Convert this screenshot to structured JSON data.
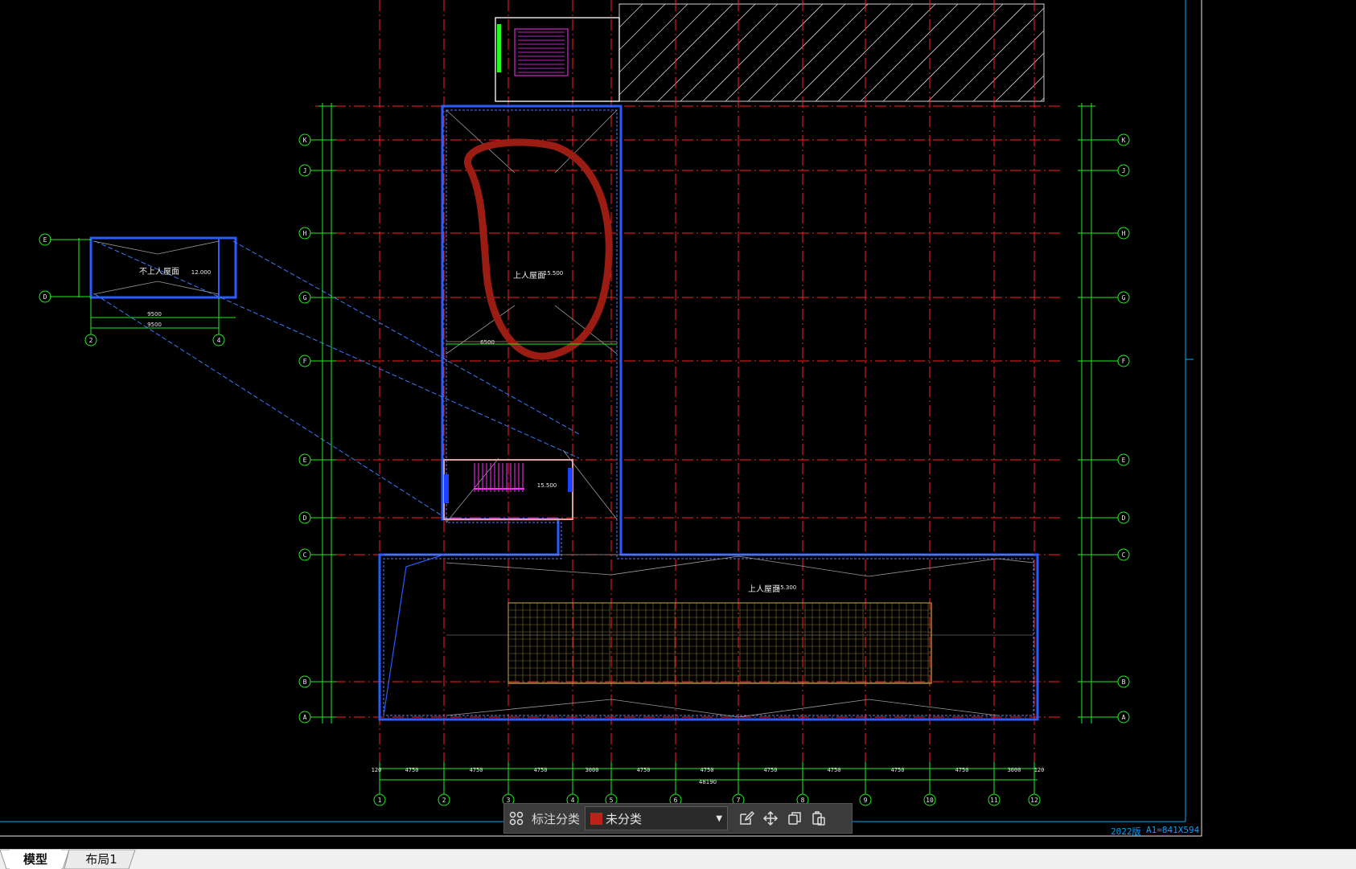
{
  "drawing": {
    "roof_label_main": "上人屋面",
    "roof_label_main_elev": "15.500",
    "roof_label_left": "不上人屋面",
    "roof_label_left_elev": "12.000",
    "roof_label_bottom": "上人屋面",
    "roof_label_bottom_elev": "15.300",
    "stair_elev": "15.500",
    "dim_total_bottom": "48190",
    "dim_6500": "6500",
    "dim_9500a": "9500",
    "dim_9500b": "9500",
    "bottom_dims": [
      "120",
      "4750",
      "4750",
      "4750",
      "3000",
      "4750",
      "4750",
      "4750",
      "4750",
      "4750",
      "4750",
      "3000",
      "120"
    ],
    "bottom_axes": [
      "1",
      "2",
      "3",
      "4",
      "5",
      "6",
      "7",
      "8",
      "9",
      "10",
      "11",
      "12"
    ],
    "left_axes": [
      "K",
      "J",
      "H",
      "G",
      "F",
      "E",
      "D",
      "C",
      "B",
      "A"
    ],
    "right_axes": [
      "K",
      "J",
      "H",
      "G",
      "F",
      "E",
      "D",
      "C",
      "B",
      "A"
    ],
    "small_axes_left": [
      "E",
      "D"
    ],
    "small_axes_bottom": [
      "2",
      "4"
    ],
    "year_label": "2022版",
    "sheet_label": "A1=841X594"
  },
  "toolbar": {
    "grid_icon": "grid-icon",
    "label": "标注分类",
    "dropdown_value": "未分类",
    "dropdown_color": "#c0201a",
    "edit_icon": "edit-icon",
    "move_icon": "move-icon",
    "copy_icon": "copy-icon",
    "paste_icon": "paste-icon"
  },
  "tabs": [
    {
      "label": "模型",
      "active": true
    },
    {
      "label": "布局1",
      "active": false
    }
  ]
}
